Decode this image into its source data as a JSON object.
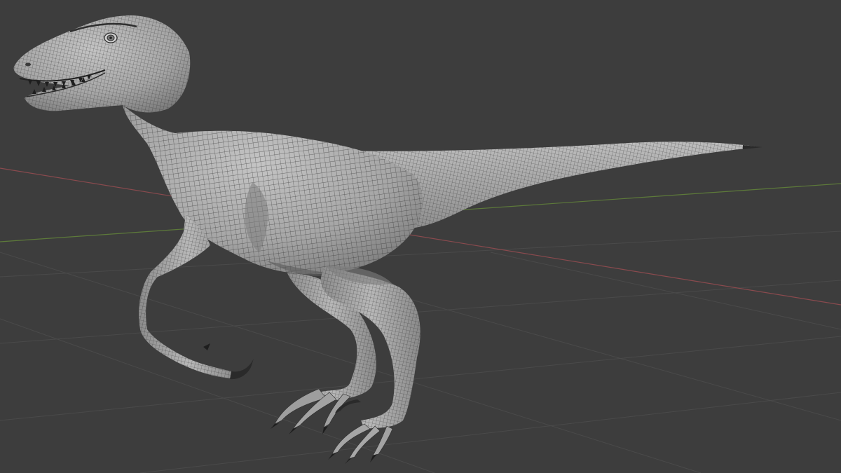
{
  "viewport": {
    "background_color": "#3d3d3d",
    "grid_color": "#4a4a4a",
    "x_axis_color": "#8a4a4e",
    "y_axis_color": "#5d7a3a",
    "wireframe_color": "#2a2a2a"
  },
  "model": {
    "object": "raptor-dinosaur-mesh",
    "shading": "solid",
    "overlay": "wireframe",
    "base_color": "#a9a9a9",
    "highlight_color": "#c8c8c8",
    "shadow_color": "#6e6e6e"
  }
}
